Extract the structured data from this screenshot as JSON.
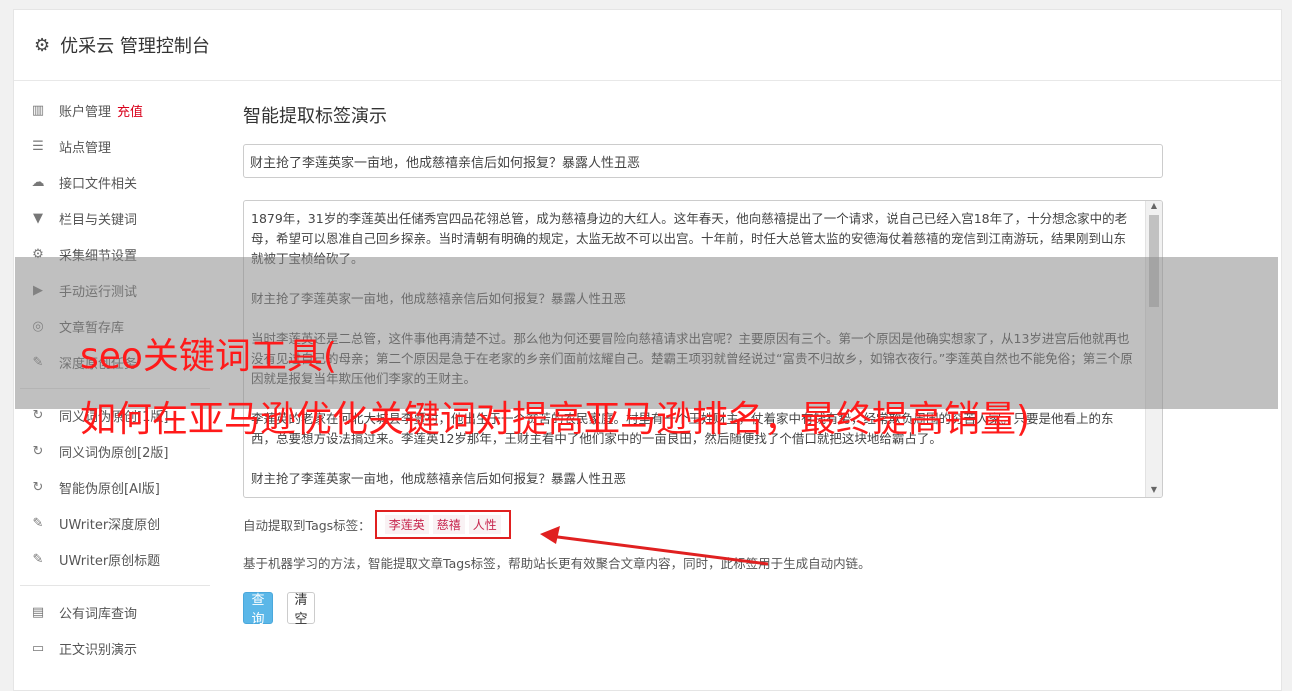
{
  "header": {
    "title": "优采云 管理控制台",
    "icon": "gear-icon"
  },
  "sidebar": {
    "items": [
      {
        "label": "账户管理",
        "badge": "充值",
        "icon": "bar-chart-icon",
        "glyph": "▥"
      },
      {
        "label": "站点管理",
        "icon": "server-icon",
        "glyph": "☰"
      },
      {
        "label": "接口文件相关",
        "icon": "cloud-upload-icon",
        "glyph": "☁"
      },
      {
        "label": "栏目与关键词",
        "icon": "filter-icon",
        "glyph": "▼"
      },
      {
        "label": "采集细节设置",
        "icon": "cogs-icon",
        "glyph": "⚙"
      },
      {
        "label": "手动运行测试",
        "icon": "play-icon",
        "glyph": "▶"
      },
      {
        "label": "文章暂存库",
        "icon": "database-icon",
        "glyph": "◎"
      },
      {
        "label": "深度原创任务",
        "icon": "edit-icon",
        "glyph": "✎"
      }
    ],
    "items2": [
      {
        "label": "同义词伪原创[1版]",
        "icon": "refresh-icon",
        "glyph": "↻"
      },
      {
        "label": "同义词伪原创[2版]",
        "icon": "refresh-icon",
        "glyph": "↻"
      },
      {
        "label": "智能伪原创[AI版]",
        "icon": "refresh-icon",
        "glyph": "↻"
      },
      {
        "label": "UWriter深度原创",
        "icon": "edit-icon",
        "glyph": "✎"
      },
      {
        "label": "UWriter原创标题",
        "icon": "edit-icon",
        "glyph": "✎"
      }
    ],
    "items3": [
      {
        "label": "公有词库查询",
        "icon": "book-icon",
        "glyph": "▤"
      },
      {
        "label": "正文识别演示",
        "icon": "window-icon",
        "glyph": "▭"
      }
    ]
  },
  "main": {
    "heading": "智能提取标签演示",
    "title_value": "财主抢了李莲英家一亩地，他成慈禧亲信后如何报复？暴露人性丑恶",
    "article": "1879年，31岁的李莲英出任储秀宫四品花翎总管，成为慈禧身边的大红人。这年春天，他向慈禧提出了一个请求，说自己已经入宫18年了，十分想念家中的老母，希望可以恩准自己回乡探亲。当时清朝有明确的规定，太监无故不可以出宫。十年前，时任大总管太监的安德海仗着慈禧的宠信到江南游玩，结果刚到山东就被丁宝桢给砍了。\n\n财主抢了李莲英家一亩地，他成慈禧亲信后如何报复？暴露人性丑恶\n\n当时李莲英还是二总管，这件事他再清楚不过。那么他为何还要冒险向慈禧请求出宫呢？主要原因有三个。第一个原因是他确实想家了，从13岁进宫后他就再也没有见过自己的母亲；第二个原因是急于在老家的乡亲们面前炫耀自己。楚霸王项羽就曾经说过“富贵不归故乡，如锦衣夜行。”李莲英自然也不能免俗；第三个原因就是报复当年欺压他们李家的王财主。\n\n李莲英的老家在河北大城县李贾村，他出生于一个贫苦的农民家庭。村里有一个王姓财主，仗着家中有钱有势，经常欺负周围的穷苦人家。只要是他看上的东西，总要想方设法搞过来。李莲英12岁那年，王财主看中了他们家中的一亩良田，然后随便找了个借口就把这块地给霸占了。\n\n财主抢了李莲英家一亩地，他成慈禧亲信后如何报复？暴露人性丑恶",
    "tags_label": "自动提取到Tags标签：",
    "tags": [
      "李莲英",
      "慈禧",
      "人性"
    ],
    "description": "基于机器学习的方法，智能提取文章Tags标签，帮助站长更有效聚合文章内容，同时，此标签用于生成自动内链。",
    "query_button": "查询",
    "clear_button": "清空"
  },
  "overlay": {
    "line1": "seo关键词工具(",
    "line2": "如何在亚马逊优化关键词对提高亚马逊排名，最终提高销量)",
    "color": "#ff1a1a"
  }
}
